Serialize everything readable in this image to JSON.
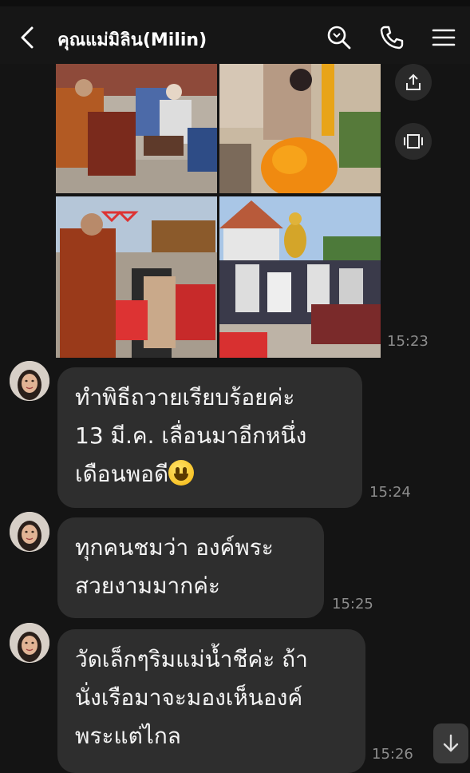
{
  "header": {
    "title": "คุณแม่มิลิน(Milin)",
    "icons": [
      "chevron-left-icon",
      "search-icon",
      "phone-icon",
      "menu-icon"
    ]
  },
  "media": {
    "time": "15:23",
    "photos": [
      "ceremony-monks-seated",
      "offering-marigolds",
      "monk-with-crowd",
      "golden-buddha-group"
    ],
    "side_buttons": [
      "share-icon",
      "expand-icon"
    ]
  },
  "messages": [
    {
      "lines": [
        "ทำพิธีถวายเรียบร้อยค่ะ",
        "13 มี.ค. เลื่อนมาอีกหนึ่ง",
        "เดือนพอดี"
      ],
      "emoji": "grinning-face",
      "time": "15:24"
    },
    {
      "lines": [
        "ทุกคนชมว่า องค์พระ",
        "สวยงามมากค่ะ"
      ],
      "time": "15:25"
    },
    {
      "lines": [
        "วัดเล็กๆริมแม่น้ำชีค่ะ ถ้า",
        "นั่งเรือมาจะมองเห็นองค์",
        "พระแต่ไกล"
      ],
      "time": "15:26"
    }
  ],
  "colors": {
    "background": "#141414",
    "bubble": "#2e2e2e",
    "time": "#8d8d8d"
  },
  "scroll_icon": "arrow-down-icon"
}
